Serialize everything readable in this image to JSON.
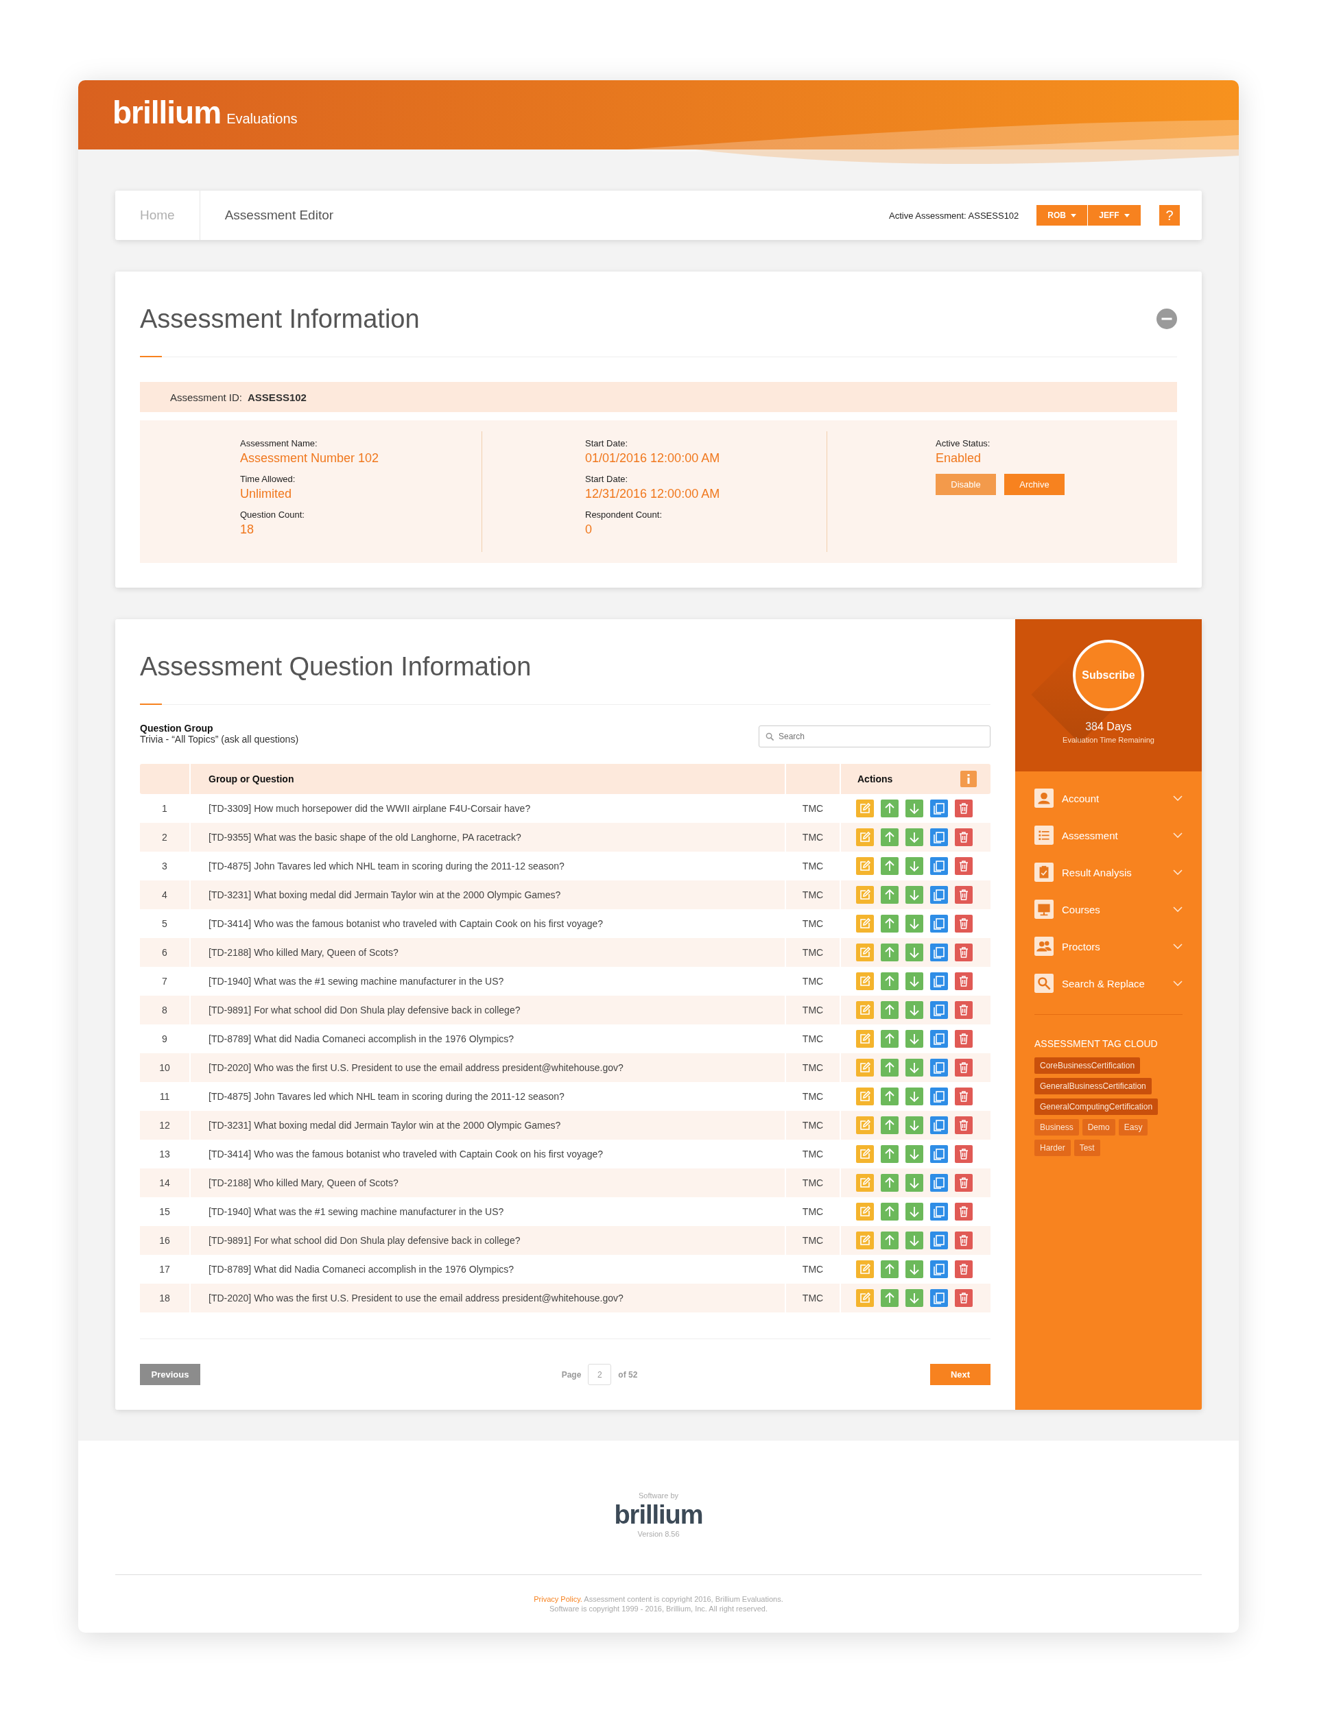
{
  "header": {
    "logo": "brillium",
    "product": "Evaluations"
  },
  "breadcrumb": {
    "items": [
      {
        "label": "Home",
        "selected": false
      },
      {
        "label": "Assessment Editor",
        "selected": true
      }
    ],
    "active_label": "Active Assessment: ASSESS102",
    "users": [
      "ROB",
      "JEFF"
    ],
    "help": "?"
  },
  "info": {
    "title": "Assessment Information",
    "id_label": "Assessment ID:",
    "id_value": "ASSESS102",
    "columns": [
      [
        {
          "label": "Assessment Name:",
          "value": "Assessment Number 102"
        },
        {
          "label": "Time Allowed:",
          "value": "Unlimited"
        },
        {
          "label": "Question Count:",
          "value": "18"
        }
      ],
      [
        {
          "label": "Start Date:",
          "value": "01/01/2016 12:00:00 AM"
        },
        {
          "label": "Start Date:",
          "value": "12/31/2016 12:00:00 AM"
        },
        {
          "label": "Respondent Count:",
          "value": "0"
        }
      ],
      [
        {
          "label": "Active Status:",
          "value": "Enabled"
        }
      ]
    ],
    "buttons": [
      {
        "label": "Disable",
        "kind": "light"
      },
      {
        "label": "Archive",
        "kind": "solid"
      }
    ]
  },
  "questions": {
    "title": "Assessment Question Information",
    "group_label": "Question Group",
    "group_value": "Trivia - “All Topics” (ask all questions)",
    "search": {
      "placeholder": "Search"
    },
    "columns": {
      "question": "Group or Question",
      "actions": "Actions"
    },
    "rows": [
      {
        "n": "1",
        "question": "[TD-3309] How much horsepower did the WWII airplane F4U-Corsair have?",
        "type": "TMC"
      },
      {
        "n": "2",
        "question": "[TD-9355] What was the basic shape of the old Langhorne, PA racetrack?",
        "type": "TMC"
      },
      {
        "n": "3",
        "question": "[TD-4875] John Tavares led which NHL team in scoring during the 2011-12 season?",
        "type": "TMC"
      },
      {
        "n": "4",
        "question": "[TD-3231] What boxing medal did Jermain Taylor win at the 2000 Olympic Games?",
        "type": "TMC"
      },
      {
        "n": "5",
        "question": "[TD-3414] Who was the famous botanist who traveled with Captain Cook on his first voyage?",
        "type": "TMC"
      },
      {
        "n": "6",
        "question": "[TD-2188] Who killed Mary, Queen of Scots?",
        "type": "TMC"
      },
      {
        "n": "7",
        "question": "[TD-1940] What was the #1 sewing machine manufacturer in the US?",
        "type": "TMC"
      },
      {
        "n": "8",
        "question": "[TD-9891] For what school did Don Shula play defensive back in college?",
        "type": "TMC"
      },
      {
        "n": "9",
        "question": "[TD-8789] What did Nadia Comaneci accomplish in the 1976 Olympics?",
        "type": "TMC"
      },
      {
        "n": "10",
        "question": "[TD-2020] Who was the first U.S. President to use the email address president@whitehouse.gov?",
        "type": "TMC"
      },
      {
        "n": "11",
        "question": "[TD-4875] John Tavares led which NHL team in scoring during the 2011-12 season?",
        "type": "TMC"
      },
      {
        "n": "12",
        "question": "[TD-3231] What boxing medal did Jermain Taylor win at the 2000 Olympic Games?",
        "type": "TMC"
      },
      {
        "n": "13",
        "question": "[TD-3414] Who was the famous botanist who traveled with Captain Cook on his first voyage?",
        "type": "TMC"
      },
      {
        "n": "14",
        "question": "[TD-2188] Who killed Mary, Queen of Scots?",
        "type": "TMC"
      },
      {
        "n": "15",
        "question": "[TD-1940] What was the #1 sewing machine manufacturer in the US?",
        "type": "TMC"
      },
      {
        "n": "16",
        "question": "[TD-9891] For what school did Don Shula play defensive back in college?",
        "type": "TMC"
      },
      {
        "n": "17",
        "question": "[TD-8789] What did Nadia Comaneci accomplish in the 1976 Olympics?",
        "type": "TMC"
      },
      {
        "n": "18",
        "question": "[TD-2020] Who was the first U.S. President to use the email address president@whitehouse.gov?",
        "type": "TMC"
      }
    ],
    "pagination": {
      "previous": "Previous",
      "page_label": "Page",
      "page": "2",
      "of": "of 52",
      "next": "Next"
    }
  },
  "sidebar": {
    "subscribe": "Subscribe",
    "days": "384 Days",
    "remaining": "Evaluation Time Remaining",
    "menu": [
      {
        "label": "Account"
      },
      {
        "label": "Assessment"
      },
      {
        "label": "Result Analysis"
      },
      {
        "label": "Courses"
      },
      {
        "label": "Proctors"
      },
      {
        "label": "Search & Replace"
      }
    ],
    "tag_title": "ASSESSMENT TAG CLOUD",
    "tags": [
      {
        "label": "CoreBusinessCertification",
        "color": "#c9500c"
      },
      {
        "label": "GeneralBusinessCertification",
        "color": "#c9500c"
      },
      {
        "label": "GeneralComputingCertification",
        "color": "#c9500c"
      },
      {
        "label": "Business",
        "color": "#e2691a"
      },
      {
        "label": "Demo",
        "color": "#e2691a"
      },
      {
        "label": "Easy",
        "color": "#e2691a"
      },
      {
        "label": "Harder",
        "color": "#e2691a"
      },
      {
        "label": "Test",
        "color": "#e2691a"
      }
    ]
  },
  "footer": {
    "software_by": "Software by",
    "logo": "brillium",
    "version": "Version 8.56",
    "privacy": "Privacy Policy.",
    "copyright_1": "Assessment content is copyright 2016, Brillium Evaluations.",
    "copyright_2": "Software is copyright 1999 - 2016, Brillium, Inc. All right reserved."
  }
}
